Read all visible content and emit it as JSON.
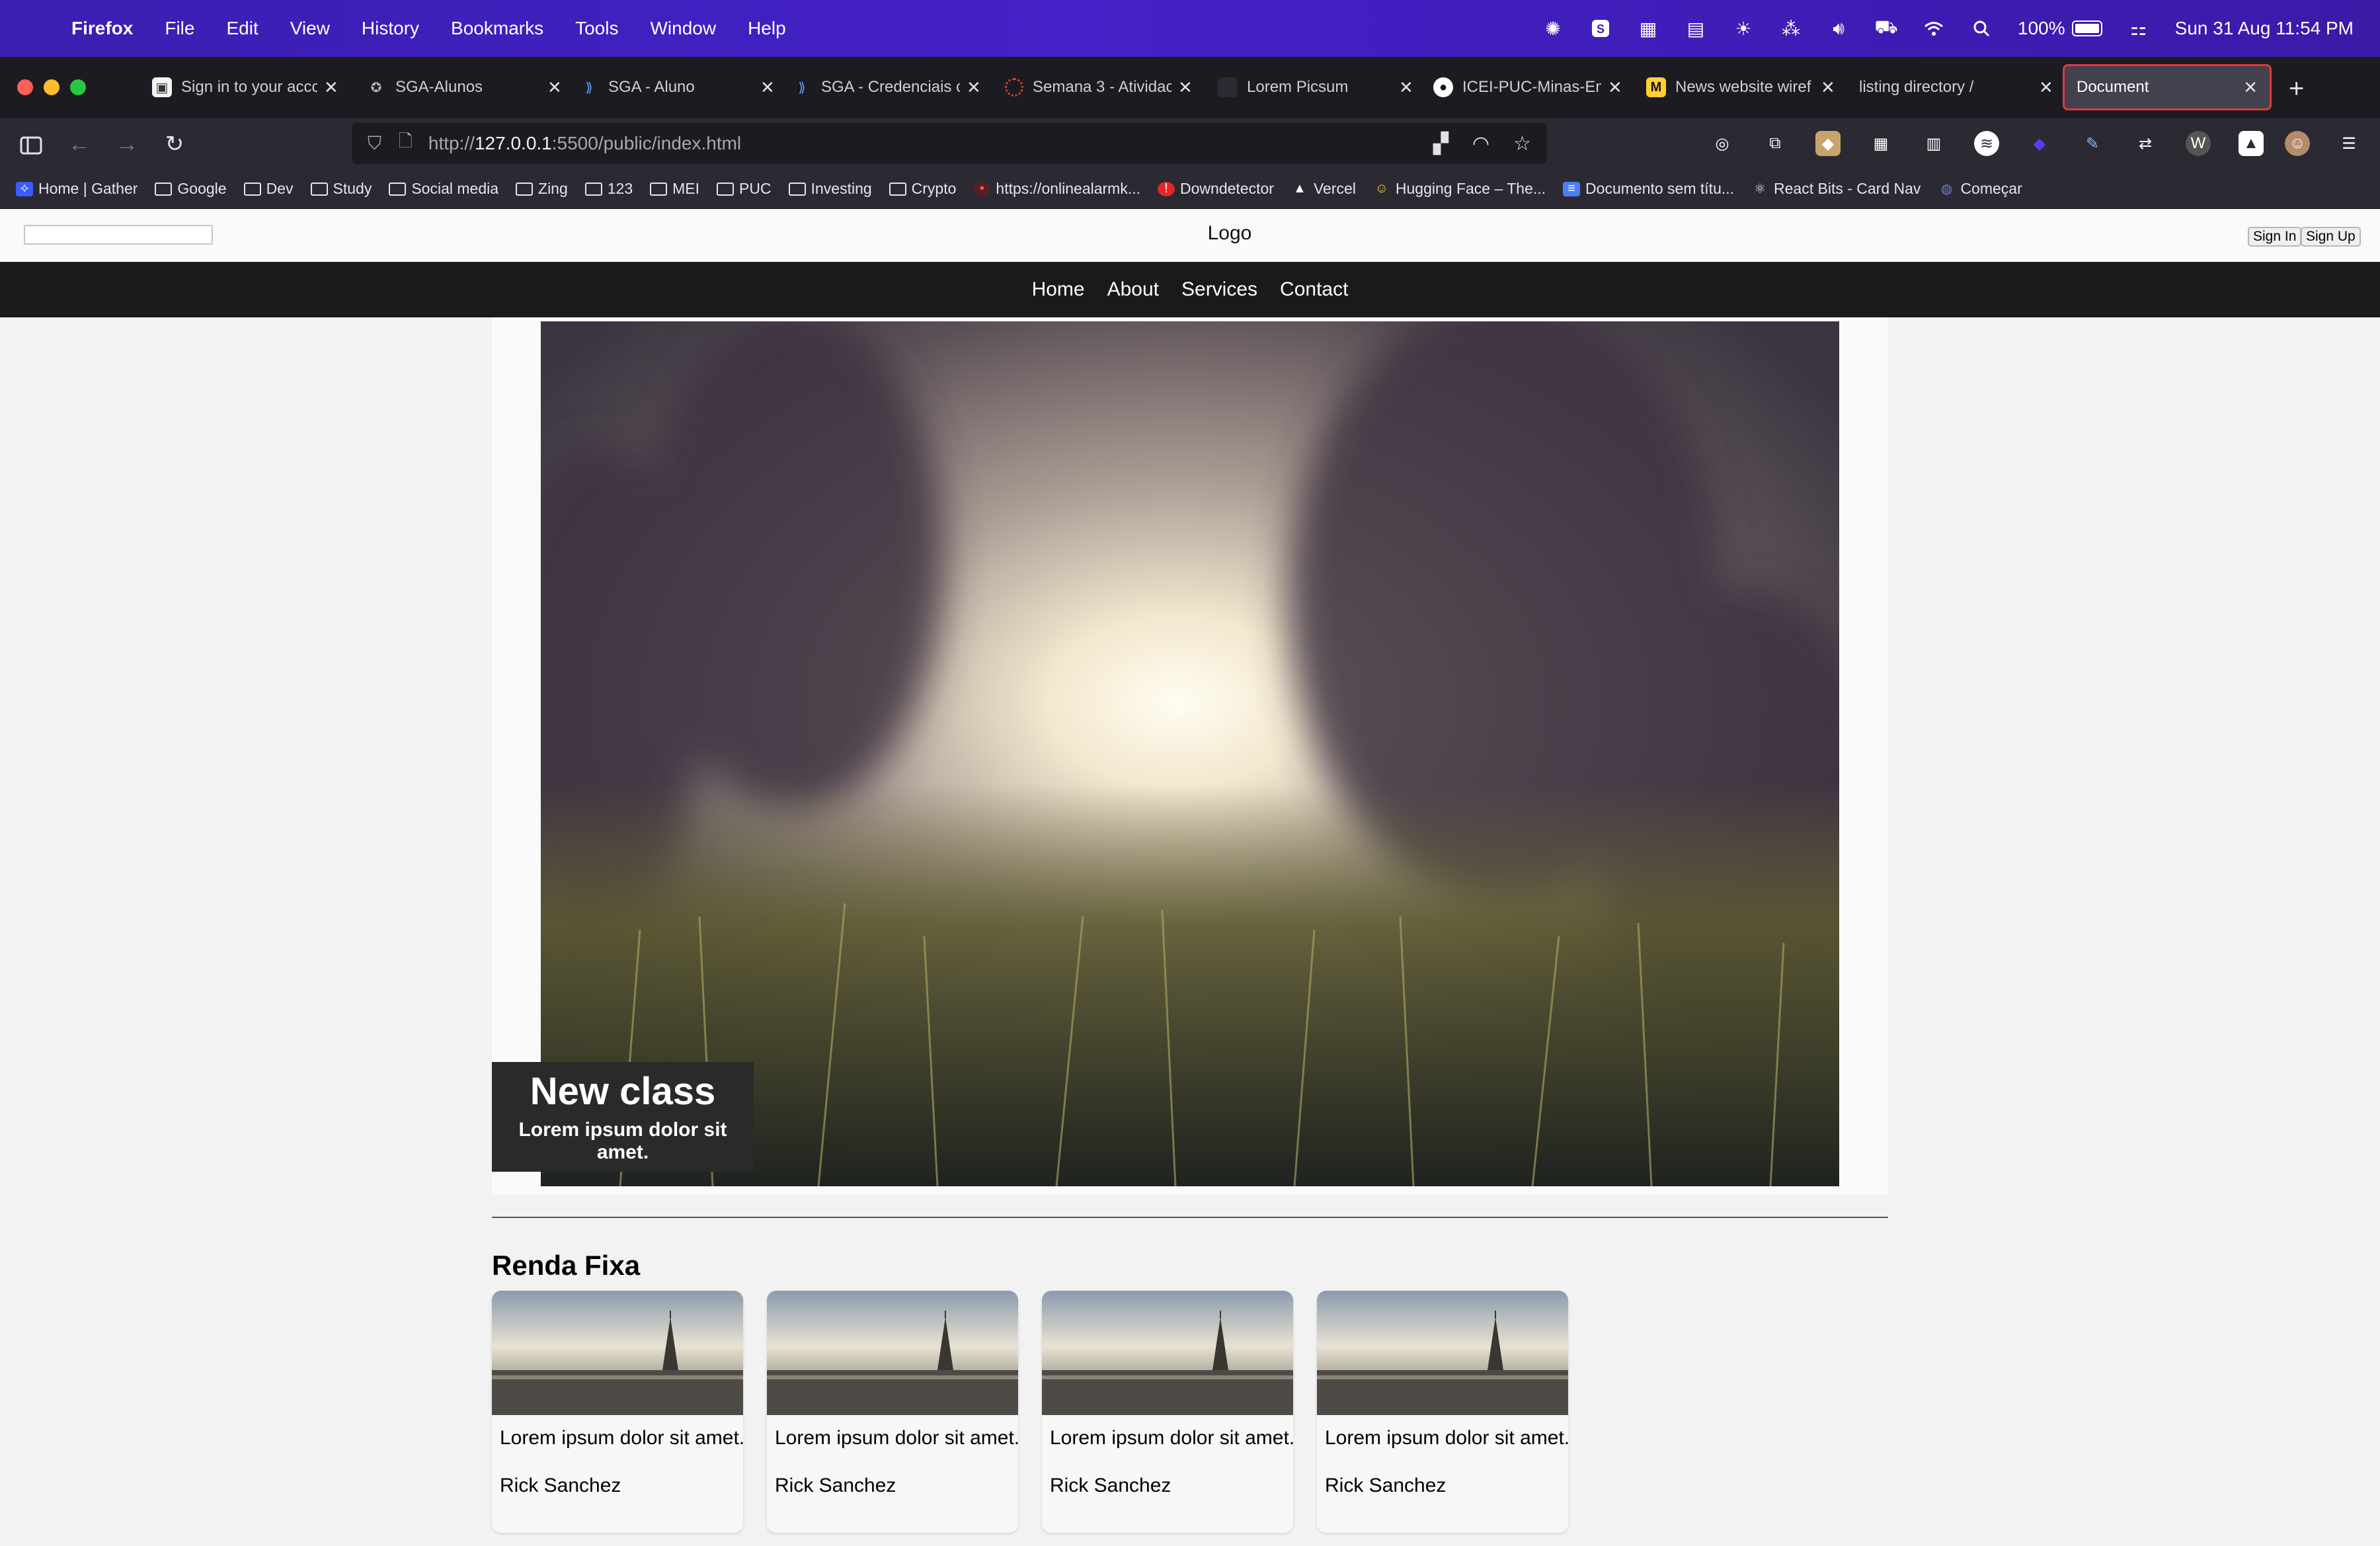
{
  "menubar": {
    "app": "Firefox",
    "items": [
      "File",
      "Edit",
      "View",
      "History",
      "Bookmarks",
      "Tools",
      "Window",
      "Help"
    ],
    "battery": "100%",
    "datetime": "Sun 31 Aug  11:54 PM"
  },
  "tabs": [
    {
      "title": "Sign in to your acco",
      "icon": "account-icon"
    },
    {
      "title": "SGA-Alunos",
      "icon": "sga-icon"
    },
    {
      "title": "SGA - Aluno",
      "icon": "sga-logo-icon"
    },
    {
      "title": "SGA - Credenciais c",
      "icon": "sga-logo-icon"
    },
    {
      "title": "Semana 3 - Atividac",
      "icon": "course-icon"
    },
    {
      "title": "Lorem Picsum",
      "icon": "picsum-icon"
    },
    {
      "title": "ICEI-PUC-Minas-En",
      "icon": "github-icon"
    },
    {
      "title": "News website wiref",
      "icon": "miro-icon"
    },
    {
      "title": "listing directory /",
      "icon": ""
    },
    {
      "title": "Document",
      "icon": "",
      "active": true
    }
  ],
  "url": {
    "prefix": "http://",
    "host": "127.0.0.1",
    "rest": ":5500/public/index.html"
  },
  "bookmarks": [
    {
      "label": "Home | Gather",
      "icon": "gather-icon"
    },
    {
      "label": "Google",
      "icon": "folder-icon"
    },
    {
      "label": "Dev",
      "icon": "folder-icon"
    },
    {
      "label": "Study",
      "icon": "folder-icon"
    },
    {
      "label": "Social media",
      "icon": "folder-icon"
    },
    {
      "label": "Zing",
      "icon": "folder-icon"
    },
    {
      "label": "123",
      "icon": "folder-icon"
    },
    {
      "label": "MEI",
      "icon": "folder-icon"
    },
    {
      "label": "PUC",
      "icon": "folder-icon"
    },
    {
      "label": "Investing",
      "icon": "folder-icon"
    },
    {
      "label": "Crypto",
      "icon": "folder-icon"
    },
    {
      "label": "https://onlinealarmk...",
      "icon": "alarm-icon"
    },
    {
      "label": "Downdetector",
      "icon": "downdetector-icon"
    },
    {
      "label": "Vercel",
      "icon": "vercel-icon"
    },
    {
      "label": "Hugging Face – The...",
      "icon": "huggingface-icon"
    },
    {
      "label": "Documento sem títu...",
      "icon": "docs-icon"
    },
    {
      "label": "React Bits - Card Nav",
      "icon": "react-icon"
    },
    {
      "label": "Começar",
      "icon": "globe-icon"
    }
  ],
  "site": {
    "search_value": "",
    "logo": "Logo",
    "sign_in": "Sign In",
    "sign_up": "Sign Up",
    "nav": [
      "Home",
      "About",
      "Services",
      "Contact"
    ],
    "hero": {
      "title": "New class",
      "subtitle": "Lorem ipsum dolor sit amet."
    },
    "section_title": "Renda Fixa",
    "cards": [
      {
        "desc": "Lorem ipsum dolor sit amet.",
        "author": "Rick Sanchez"
      },
      {
        "desc": "Lorem ipsum dolor sit amet.",
        "author": "Rick Sanchez"
      },
      {
        "desc": "Lorem ipsum dolor sit amet.",
        "author": "Rick Sanchez"
      },
      {
        "desc": "Lorem ipsum dolor sit amet.",
        "author": "Rick Sanchez"
      }
    ]
  },
  "colors": {
    "menubar": "#3a1fb0",
    "tabstrip": "#1c1b22",
    "toolbar": "#2b2a33",
    "active_tab_border": "#e03a3a",
    "site_nav": "#1a1a1a",
    "caption_bg": "#2a2a2a"
  }
}
